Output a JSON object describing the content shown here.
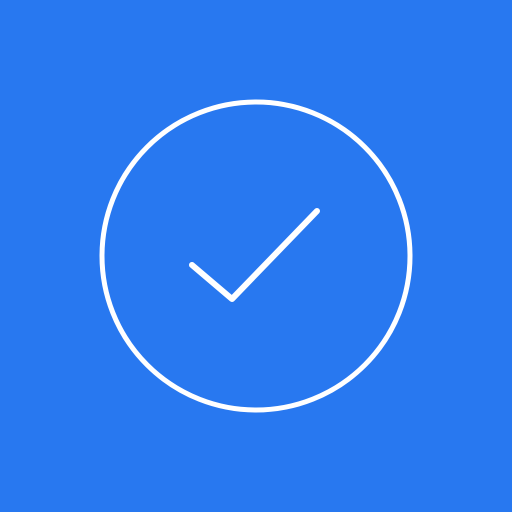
{
  "colors": {
    "background": "#2878F0",
    "foreground": "#FFFFFF"
  },
  "icon": {
    "name": "check-circle-icon"
  }
}
